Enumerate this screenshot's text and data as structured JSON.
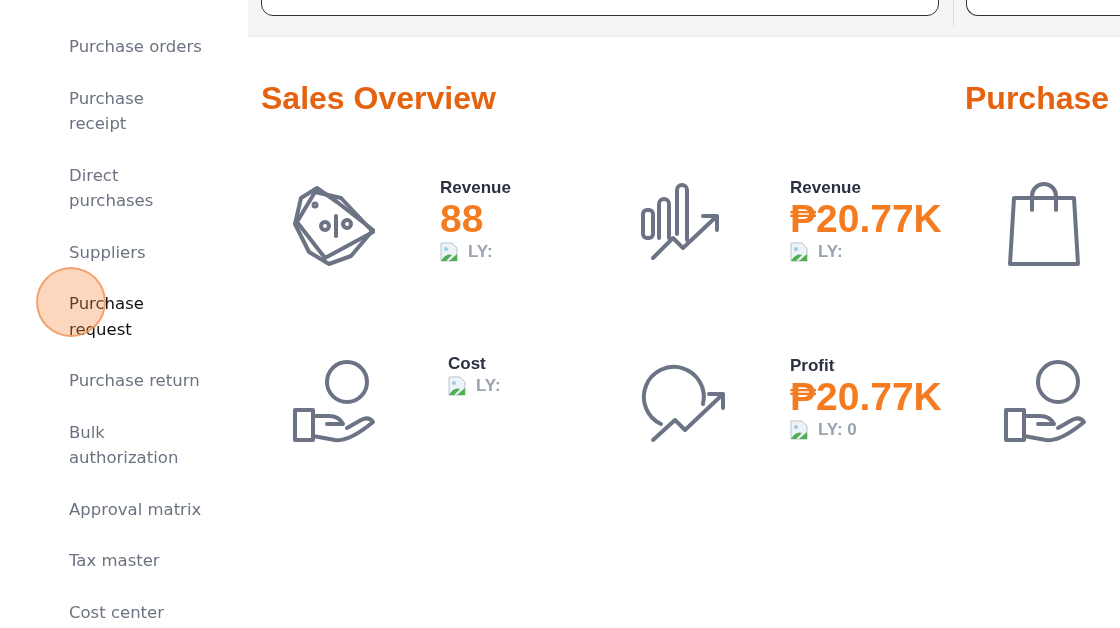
{
  "sidebar": {
    "items": [
      {
        "label": "Purchase orders",
        "selected": false
      },
      {
        "label": "Purchase receipt",
        "selected": false
      },
      {
        "label": "Direct purchases",
        "selected": false
      },
      {
        "label": "Suppliers",
        "selected": false
      },
      {
        "label": "Purchase request",
        "selected": true
      },
      {
        "label": "Purchase return",
        "selected": false
      },
      {
        "label": "Bulk authorization",
        "selected": false
      },
      {
        "label": "Approval matrix",
        "selected": false
      },
      {
        "label": "Tax master",
        "selected": false
      },
      {
        "label": "Cost center",
        "selected": false
      }
    ]
  },
  "sections": [
    {
      "title": "Sales Overview",
      "cards": [
        {
          "kind": "tag",
          "label": "Revenue",
          "value": "88",
          "ly": "LY:"
        },
        {
          "kind": "chart",
          "label": "Revenue",
          "value": "₱20.77K",
          "ly": "LY:"
        },
        {
          "kind": "coin-hand",
          "label": "Cost",
          "ly": "LY:"
        },
        {
          "kind": "growth",
          "label": "Profit",
          "value": "₱20.77K",
          "ly": "LY: 0"
        }
      ]
    },
    {
      "title": "Purchase",
      "cards": [
        {
          "kind": "bag"
        },
        {
          "kind": "coin-hand"
        }
      ]
    }
  ]
}
